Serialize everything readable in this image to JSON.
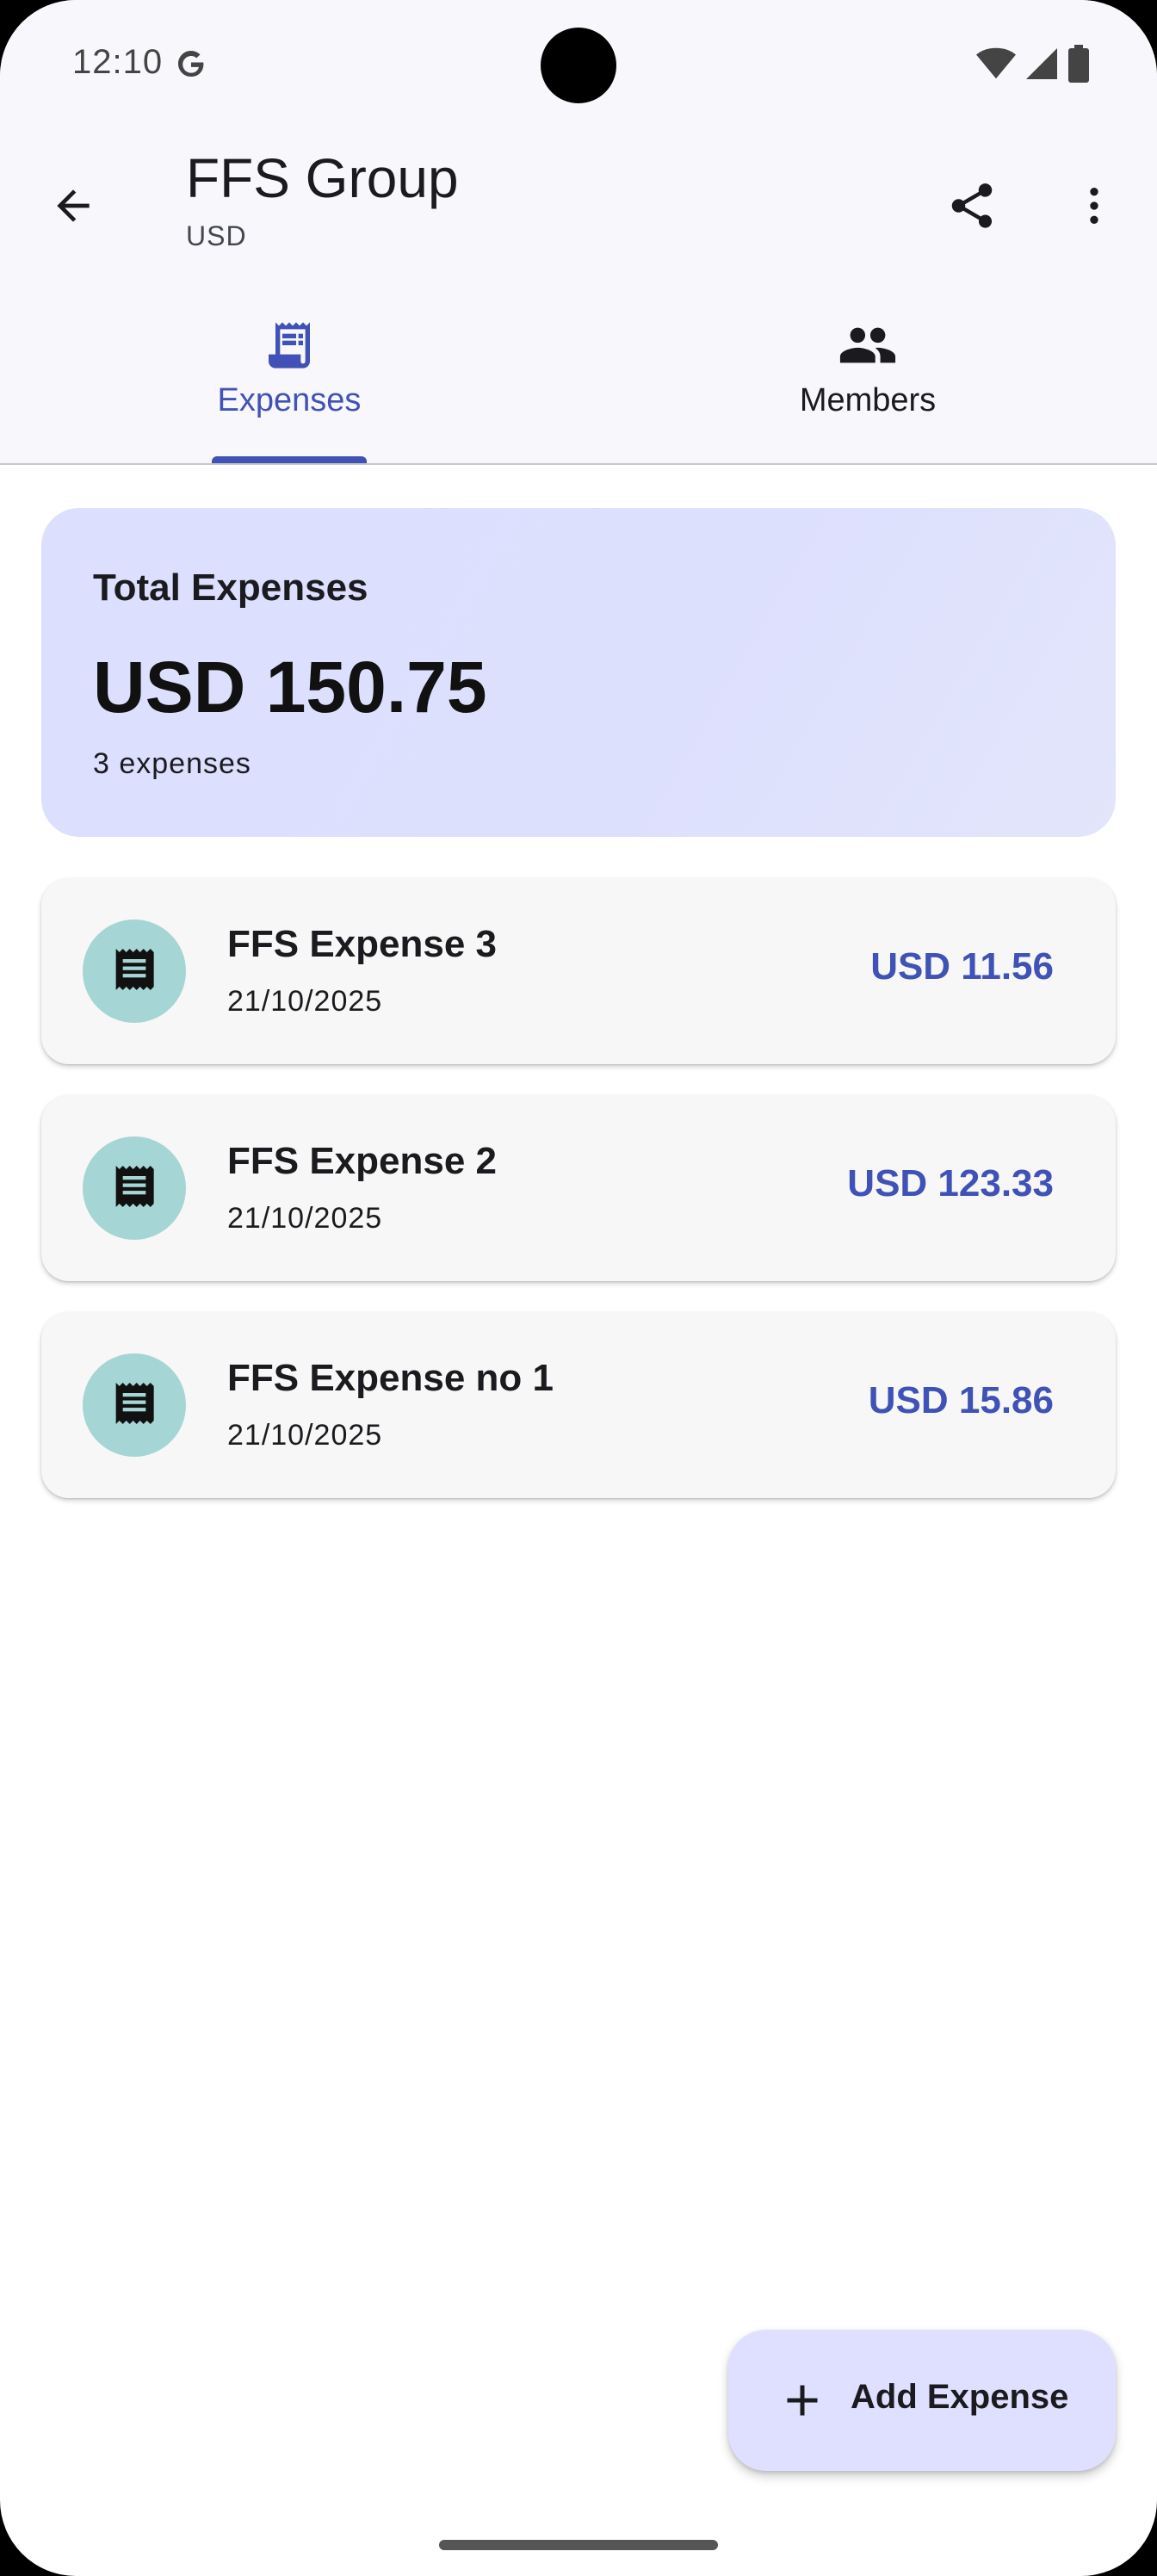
{
  "status_bar": {
    "time": "12:10"
  },
  "app_bar": {
    "title": "FFS Group",
    "subtitle": "USD"
  },
  "tabs": [
    {
      "label": "Expenses",
      "icon": "receipt-icon",
      "selected": true
    },
    {
      "label": "Members",
      "icon": "people-icon",
      "selected": false
    }
  ],
  "summary": {
    "label": "Total Expenses",
    "total": "USD 150.75",
    "count": "3 expenses"
  },
  "expenses": [
    {
      "name": "FFS Expense 3",
      "date": "21/10/2025",
      "amount": "USD 11.56"
    },
    {
      "name": "FFS Expense 2",
      "date": "21/10/2025",
      "amount": "USD 123.33"
    },
    {
      "name": "FFS Expense no 1",
      "date": "21/10/2025",
      "amount": "USD 15.86"
    }
  ],
  "fab": {
    "label": "Add Expense"
  },
  "colors": {
    "accent": "#4052b5",
    "summary_bg": "#dcdffe",
    "avatar_bg": "#a5d5d4",
    "fab_bg": "#dfe0ff"
  }
}
